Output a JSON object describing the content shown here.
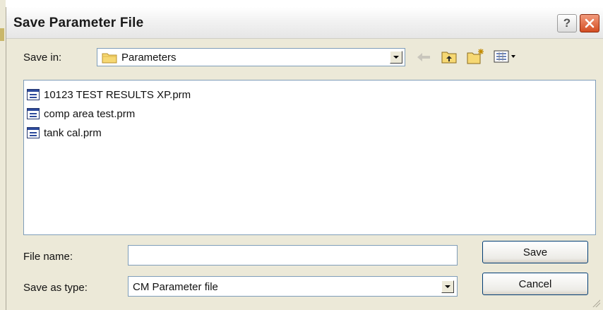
{
  "dialog": {
    "title": "Save Parameter File",
    "help_label": "?"
  },
  "toolbar": {
    "save_in_label": "Save in:",
    "folder_name": "Parameters",
    "icons": [
      "back-icon",
      "up-folder-icon",
      "new-folder-icon",
      "view-menu-icon"
    ]
  },
  "files": [
    {
      "name": "10123 TEST RESULTS XP.prm",
      "icon": "prm-file-icon"
    },
    {
      "name": "comp area test.prm",
      "icon": "prm-file-icon"
    },
    {
      "name": "tank cal.prm",
      "icon": "prm-file-icon"
    }
  ],
  "form": {
    "file_name_label": "File name:",
    "file_name_value": "",
    "save_as_type_label": "Save as type:",
    "save_as_type_value": "CM Parameter file"
  },
  "buttons": {
    "save": "Save",
    "cancel": "Cancel"
  }
}
